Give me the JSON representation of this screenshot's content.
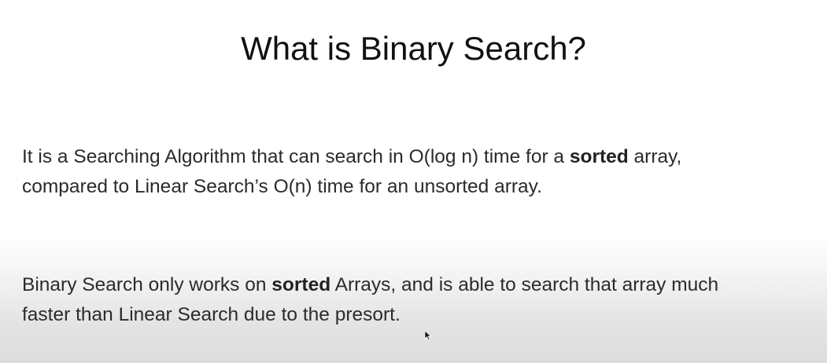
{
  "slide": {
    "title": "What is Binary Search?",
    "paragraph1": {
      "line1_before": "It is a Searching Algorithm that can search in O(log n) time for a ",
      "line1_bold": "sorted",
      "line1_after": " array,",
      "line2": "compared to Linear Search’s O(n) time for an unsorted array."
    },
    "paragraph2": {
      "line1_before": "Binary Search only works on ",
      "line1_bold": "sorted",
      "line1_after": " Arrays, and is able to search that array much",
      "line2": "faster than Linear Search due to the presort."
    }
  },
  "icons": {
    "cursor": "mouse-pointer-icon"
  }
}
